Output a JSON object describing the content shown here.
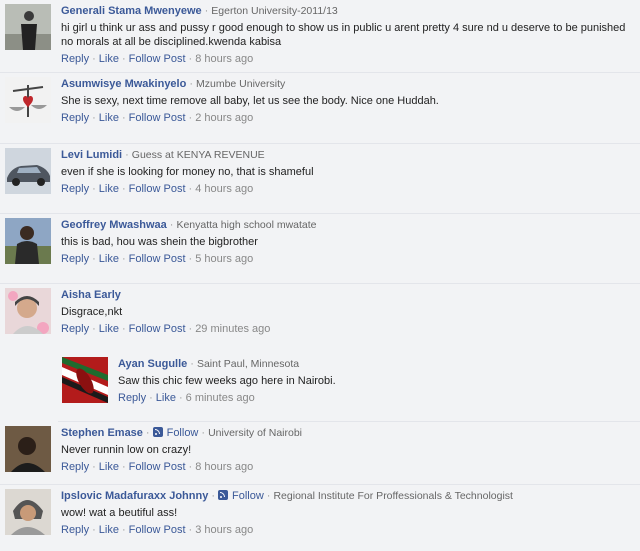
{
  "actions": {
    "reply": "Reply",
    "like": "Like",
    "follow_post": "Follow Post",
    "follow": "Follow",
    "dot": "·"
  },
  "comments": [
    {
      "name": "Generali Stama Mwenyewe",
      "meta": "Egerton University-2011/13",
      "text": "hi girl u think ur ass and pussy r good enough to show us in public u arent pretty 4 sure nd u deserve to be punished no morals at all be disciplined.kwenda kabisa",
      "time": "8 hours ago"
    },
    {
      "name": "Asumwisye Mwakinyelo",
      "meta": "Mzumbe University",
      "text": "She is sexy, next time remove all baby, let us see the body. Nice one Huddah.",
      "time": "2 hours ago"
    },
    {
      "name": "Levi Lumidi",
      "meta": "Guess at KENYA REVENUE",
      "text": "even if she is looking for money no, that is shameful",
      "time": "4 hours ago"
    },
    {
      "name": "Geoffrey Mwashwaa",
      "meta": "Kenyatta high school mwatate",
      "text": "this is bad, hou was shein the bigbrother",
      "time": "5 hours ago"
    },
    {
      "name": "Aisha Early",
      "meta": "",
      "text": "Disgrace,nkt",
      "time": "29 minutes ago"
    },
    {
      "name": "Ayan Sugulle",
      "meta": "Saint Paul, Minnesota",
      "text": "Saw this chic few weeks ago here in Nairobi.",
      "time": "6 minutes ago"
    },
    {
      "name": "Stephen Emase",
      "meta": "University of Nairobi",
      "text": "Never runnin low on crazy!",
      "time": "8 hours ago"
    },
    {
      "name": "Ipslovic Madafuraxx Johnny",
      "meta": "Regional Institute For Proffessionals & Technologist",
      "text": "wow! wat a beutiful ass!",
      "time": "3 hours ago"
    }
  ]
}
